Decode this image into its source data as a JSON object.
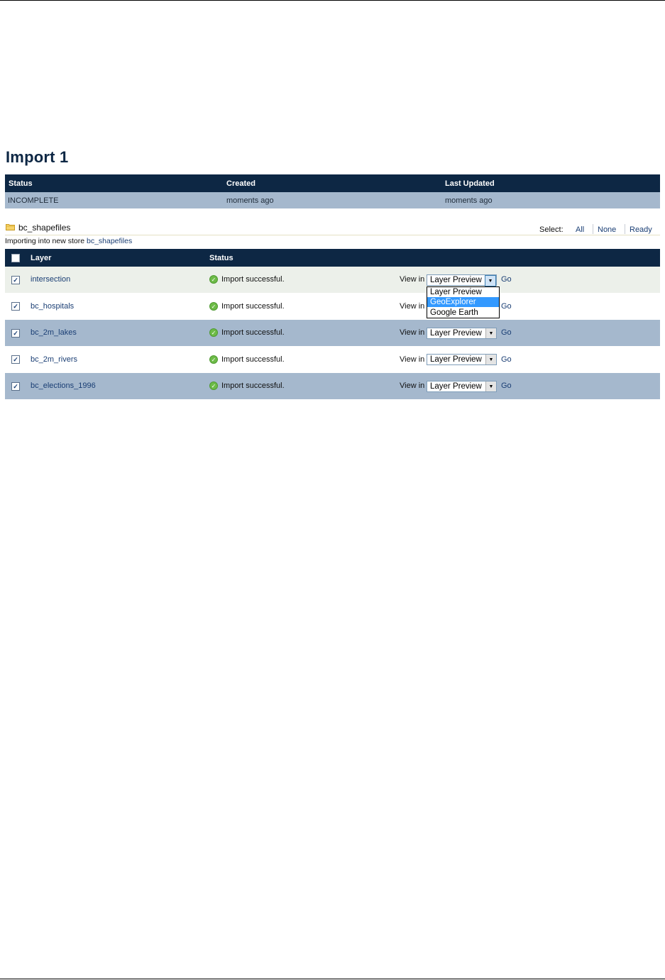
{
  "page": {
    "title": "Import 1"
  },
  "summary": {
    "headers": [
      "Status",
      "Created",
      "Last Updated"
    ],
    "row": [
      "INCOMPLETE",
      "moments ago",
      "moments ago"
    ]
  },
  "store": {
    "name": "bc_shapefiles",
    "icon": "folder-icon",
    "select_label": "Select:",
    "select_links": [
      "All",
      "None",
      "Ready"
    ],
    "importing_prefix": "Importing into new store",
    "importing_store_link": "bc_shapefiles"
  },
  "layers_table": {
    "headers": {
      "layer": "Layer",
      "status": "Status"
    },
    "view_in_label": "View in",
    "go_label": "Go",
    "rows": [
      {
        "name": "intersection",
        "checked": true,
        "status": "Import successful.",
        "view": "Layer Preview"
      },
      {
        "name": "bc_hospitals",
        "checked": true,
        "status": "Import successful.",
        "view": "Layer Preview"
      },
      {
        "name": "bc_2m_lakes",
        "checked": true,
        "status": "Import successful.",
        "view": "Layer Preview"
      },
      {
        "name": "bc_2m_rivers",
        "checked": true,
        "status": "Import successful.",
        "view": "Layer Preview"
      },
      {
        "name": "bc_elections_1996",
        "checked": true,
        "status": "Import successful.",
        "view": "Layer Preview"
      }
    ]
  },
  "dropdown": {
    "open_for_row": "intersection",
    "options": [
      "Layer Preview",
      "GeoExplorer",
      "Google Earth"
    ],
    "highlighted": "GeoExplorer"
  },
  "colors": {
    "header_bg": "#0d2744",
    "row_blue": "#a5b8cd",
    "link": "#1a3e74",
    "success": "#6dbb47",
    "highlight": "#3399ff"
  }
}
